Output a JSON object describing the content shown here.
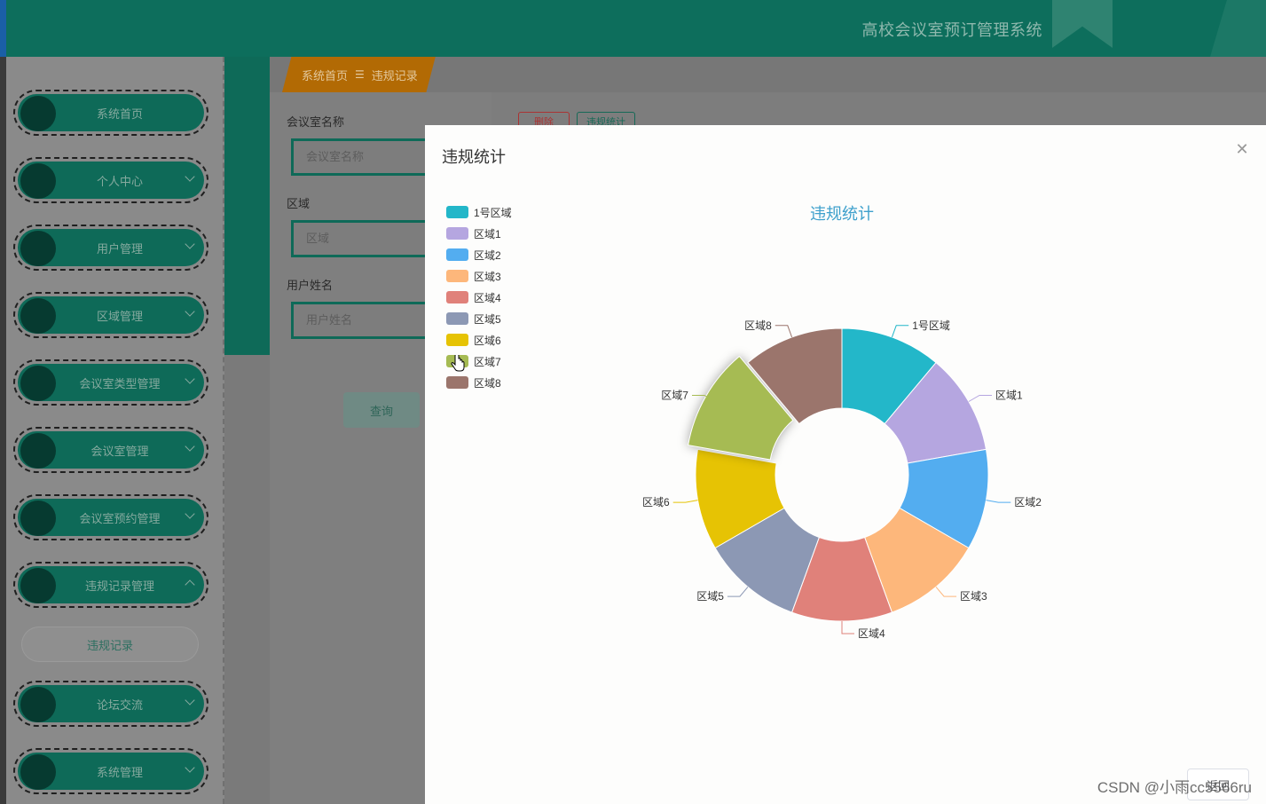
{
  "header": {
    "site_title": "高校会议室预订管理系统"
  },
  "sidebar": {
    "items": [
      {
        "label": "系统首页",
        "chevron": "none"
      },
      {
        "label": "个人中心",
        "chevron": "down"
      },
      {
        "label": "用户管理",
        "chevron": "down"
      },
      {
        "label": "区域管理",
        "chevron": "down"
      },
      {
        "label": "会议室类型管理",
        "chevron": "down"
      },
      {
        "label": "会议室管理",
        "chevron": "down"
      },
      {
        "label": "会议室预约管理",
        "chevron": "down"
      },
      {
        "label": "违规记录管理",
        "chevron": "up"
      },
      {
        "label": "论坛交流",
        "chevron": "down"
      },
      {
        "label": "系统管理",
        "chevron": "down"
      }
    ],
    "sub_item": "违规记录"
  },
  "breadcrumb": {
    "home": "系统首页",
    "separator": "☰",
    "current": "违规记录"
  },
  "filters": {
    "room_name": {
      "label": "会议室名称",
      "placeholder": "会议室名称"
    },
    "area": {
      "label": "区域",
      "placeholder": "区域"
    },
    "user_name": {
      "label": "用户姓名",
      "placeholder": "用户姓名"
    },
    "query_label": "查询"
  },
  "actions": {
    "delete_label": "删除",
    "stats_label": "违规统计"
  },
  "modal": {
    "title": "违规统计",
    "close_icon": "close-icon",
    "back_label": "返回"
  },
  "chart_data": {
    "type": "pie",
    "donut": true,
    "title": "违规统计",
    "legend_position": "top-left",
    "categories": [
      "1号区域",
      "区域1",
      "区域2",
      "区域3",
      "区域4",
      "区域5",
      "区域6",
      "区域7",
      "区域8"
    ],
    "values": [
      1,
      1,
      1,
      1,
      1,
      1,
      1,
      1,
      1
    ],
    "colors": [
      "#23b7c9",
      "#b5a6e0",
      "#53adf0",
      "#fdb77b",
      "#e0817a",
      "#8c98b4",
      "#e6c304",
      "#a6bb53",
      "#9b756c"
    ],
    "highlighted": "区域7"
  },
  "watermark": "CSDN @小雨cc5566ru"
}
